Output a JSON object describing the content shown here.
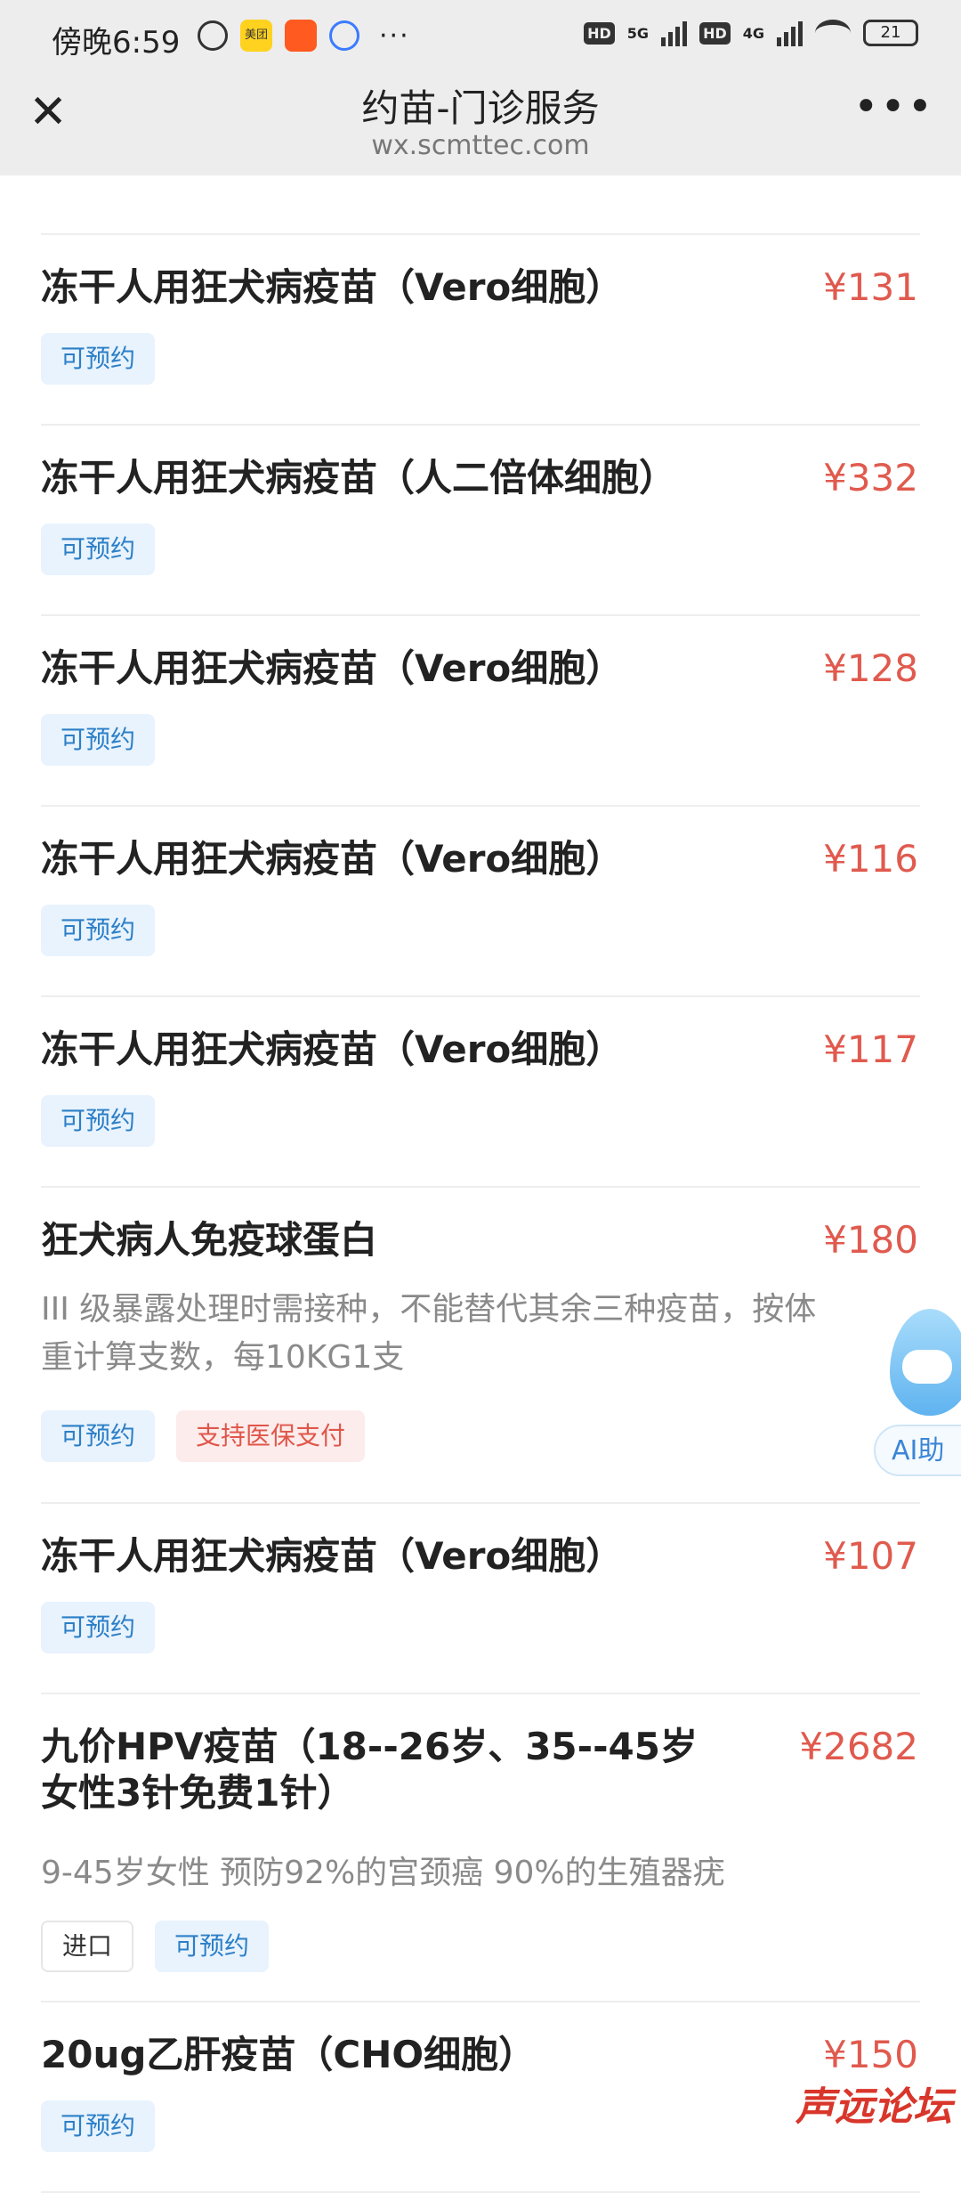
{
  "status_bar": {
    "time": "傍晚6:59",
    "meituan_label": "美团",
    "net1": "5G",
    "net2": "4G",
    "hd": "HD",
    "battery": "21"
  },
  "nav": {
    "title": "约苗-门诊服务",
    "domain": "wx.scmttec.com",
    "close_icon": "close-icon",
    "more_icon": "more-icon"
  },
  "items": [
    {
      "name": "冻干人用狂犬病疫苗（Vero细胞）",
      "price": "¥131",
      "tags": [
        "可预约"
      ]
    },
    {
      "name": "冻干人用狂犬病疫苗（人二倍体细胞）",
      "price": "¥332",
      "tags": [
        "可预约"
      ]
    },
    {
      "name": "冻干人用狂犬病疫苗（Vero细胞）",
      "price": "¥128",
      "tags": [
        "可预约"
      ]
    },
    {
      "name": "冻干人用狂犬病疫苗（Vero细胞）",
      "price": "¥116",
      "tags": [
        "可预约"
      ]
    },
    {
      "name": "冻干人用狂犬病疫苗（Vero细胞）",
      "price": "¥117",
      "tags": [
        "可预约"
      ]
    },
    {
      "name": "狂犬病人免疫球蛋白",
      "price": "¥180",
      "desc1": "III 级暴露处理时需接种，不能替代其余三种疫苗，按体",
      "desc2": "重计算支数，每10KG1支",
      "tags": [
        "可预约",
        "支持医保支付"
      ]
    },
    {
      "name": "冻干人用狂犬病疫苗（Vero细胞）",
      "price": "¥107",
      "tags": [
        "可预约"
      ]
    },
    {
      "name1": "九价HPV疫苗（18--26岁、35--45岁",
      "name2": "女性3针免费1针）",
      "price": "¥2682",
      "desc": "9-45岁女性 预防92%的宫颈癌 90%的生殖器疣",
      "tags": [
        "进口",
        "可预约"
      ]
    },
    {
      "name": "20ug乙肝疫苗（CHO细胞）",
      "price": "¥150",
      "tags": [
        "可预约"
      ]
    }
  ],
  "ai_helper": {
    "label": "AI助"
  },
  "watermark": "声远论坛"
}
